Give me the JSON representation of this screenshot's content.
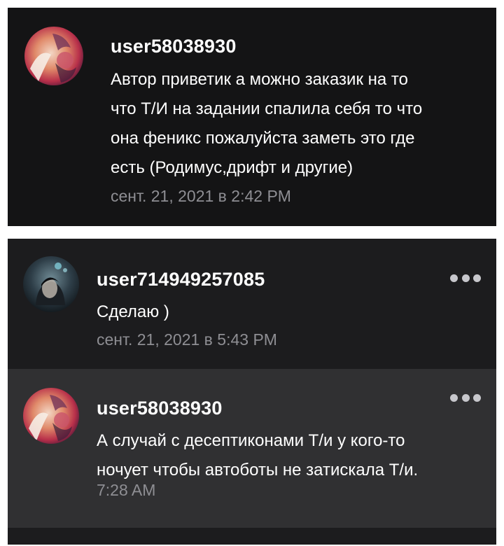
{
  "comments": [
    {
      "username": "user58038930",
      "text_lines": [
        "Автор приветик а можно заказик на то",
        "что Т/И на задании спалила себя то что",
        "она феникс пожалуйста заметь это где",
        "есть (Родимус,дрифт и другие)"
      ],
      "timestamp": "сент. 21, 2021 в 2:42 PM",
      "avatar_icon": "user-avatar-fox-art"
    },
    {
      "username": "user714949257085",
      "text_lines": [
        "Сделаю )"
      ],
      "timestamp": "сент. 21, 2021 в 5:43 PM",
      "avatar_icon": "user-avatar-dark-art",
      "more_icon": "more-options-icon"
    },
    {
      "username": "user58038930",
      "text_lines": [
        "А случай с десептиконами Т/и у кого-то",
        "ночует чтобы автоботы не затискала Т/и."
      ],
      "timestamp": "7:28 AM",
      "avatar_icon": "user-avatar-fox-art",
      "more_icon": "more-options-icon"
    }
  ],
  "colors": {
    "background_dark": "#141415",
    "background_reply": "#1c1c1e",
    "background_highlight": "#303032",
    "text_primary": "#ffffff",
    "text_secondary": "#8e8e93"
  }
}
